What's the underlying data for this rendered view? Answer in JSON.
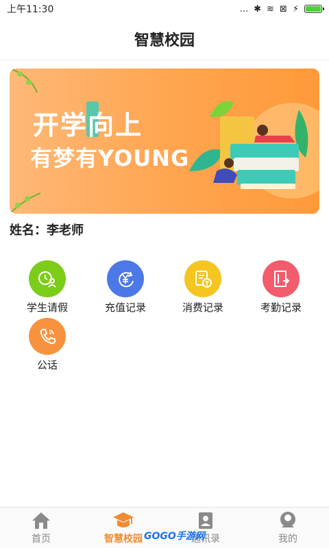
{
  "status_bar": {
    "time": "上午11:30",
    "icons": [
      "dots-icon",
      "bluetooth-icon",
      "wifi-icon",
      "sim-icon",
      "charging-icon",
      "battery-icon"
    ],
    "battery_level": 0.9,
    "dots": "...",
    "bluetooth": "✱",
    "wifi": "≋",
    "sim": "⊠",
    "charge": "⚡"
  },
  "title_bar": {
    "title": "智慧校园"
  },
  "banner": {
    "line1": "开学向上",
    "line2": "有梦有YOUNG"
  },
  "teacher": {
    "name_line": "姓名：李老师"
  },
  "menu": {
    "items": [
      {
        "label": "学生请假",
        "icon": "clock-person-icon",
        "color": "#7ccc1a"
      },
      {
        "label": "充值记录",
        "icon": "yuan-refresh-icon",
        "color": "#4d78e8"
      },
      {
        "label": "消费记录",
        "icon": "receipt-yuan-icon",
        "color": "#f5c521"
      },
      {
        "label": "考勤记录",
        "icon": "door-exit-icon",
        "color": "#f25c6c"
      },
      {
        "label": "公话",
        "icon": "phone-icon",
        "color": "#f8923e"
      }
    ]
  },
  "tab_bar": {
    "tabs": [
      {
        "label": "首页",
        "icon": "home-icon",
        "active": false
      },
      {
        "label": "智慧校园",
        "icon": "graduation-cap-icon",
        "active": true
      },
      {
        "label": "通讯录",
        "icon": "contacts-icon",
        "active": false
      },
      {
        "label": "我的",
        "icon": "profile-icon",
        "active": false
      }
    ]
  },
  "watermark": "GOGO手游网",
  "colors": {
    "accent": "#f08c32",
    "banner_orange": "#ffa44e"
  }
}
